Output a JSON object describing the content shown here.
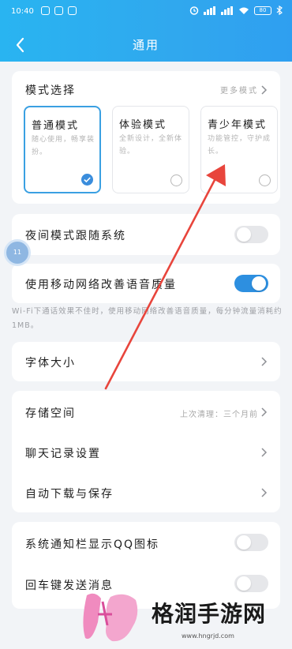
{
  "status_bar": {
    "time": "10:40",
    "battery": "80"
  },
  "header": {
    "title": "通用"
  },
  "mode_section": {
    "title": "模式选择",
    "more": "更多模式",
    "modes": [
      {
        "name": "普通模式",
        "desc": "随心使用，畅享装扮。",
        "selected": true
      },
      {
        "name": "体验模式",
        "desc": "全新设计，全新体验。",
        "selected": false
      },
      {
        "name": "青少年模式",
        "desc": "功能管控，守护成长。",
        "selected": false
      }
    ]
  },
  "night_mode": {
    "label": "夜间模式跟随系统",
    "on": false
  },
  "mobile_voice": {
    "label": "使用移动网络改善语音质量",
    "on": true,
    "hint": "Wi-Fi下通话效果不佳时，使用移动网络改善语音质量，每分钟流量消耗约1MB。"
  },
  "font_size": {
    "label": "字体大小"
  },
  "storage_group": {
    "storage": {
      "label": "存储空间",
      "value": "上次清理：三个月前"
    },
    "chat_history": {
      "label": "聊天记录设置"
    },
    "auto_download": {
      "label": "自动下载与保存"
    }
  },
  "notify_group": {
    "qq_icon": {
      "label": "系统通知栏显示QQ图标"
    },
    "enter_send": {
      "label": "回车键发送消息"
    }
  },
  "floating_badge": {
    "text": "11"
  },
  "watermark": {
    "text": "格润手游网",
    "url": "www.hngrjd.com"
  },
  "colors": {
    "accent": "#2d8fe0",
    "header": "#30a8ee",
    "arrow": "#e8453c"
  }
}
